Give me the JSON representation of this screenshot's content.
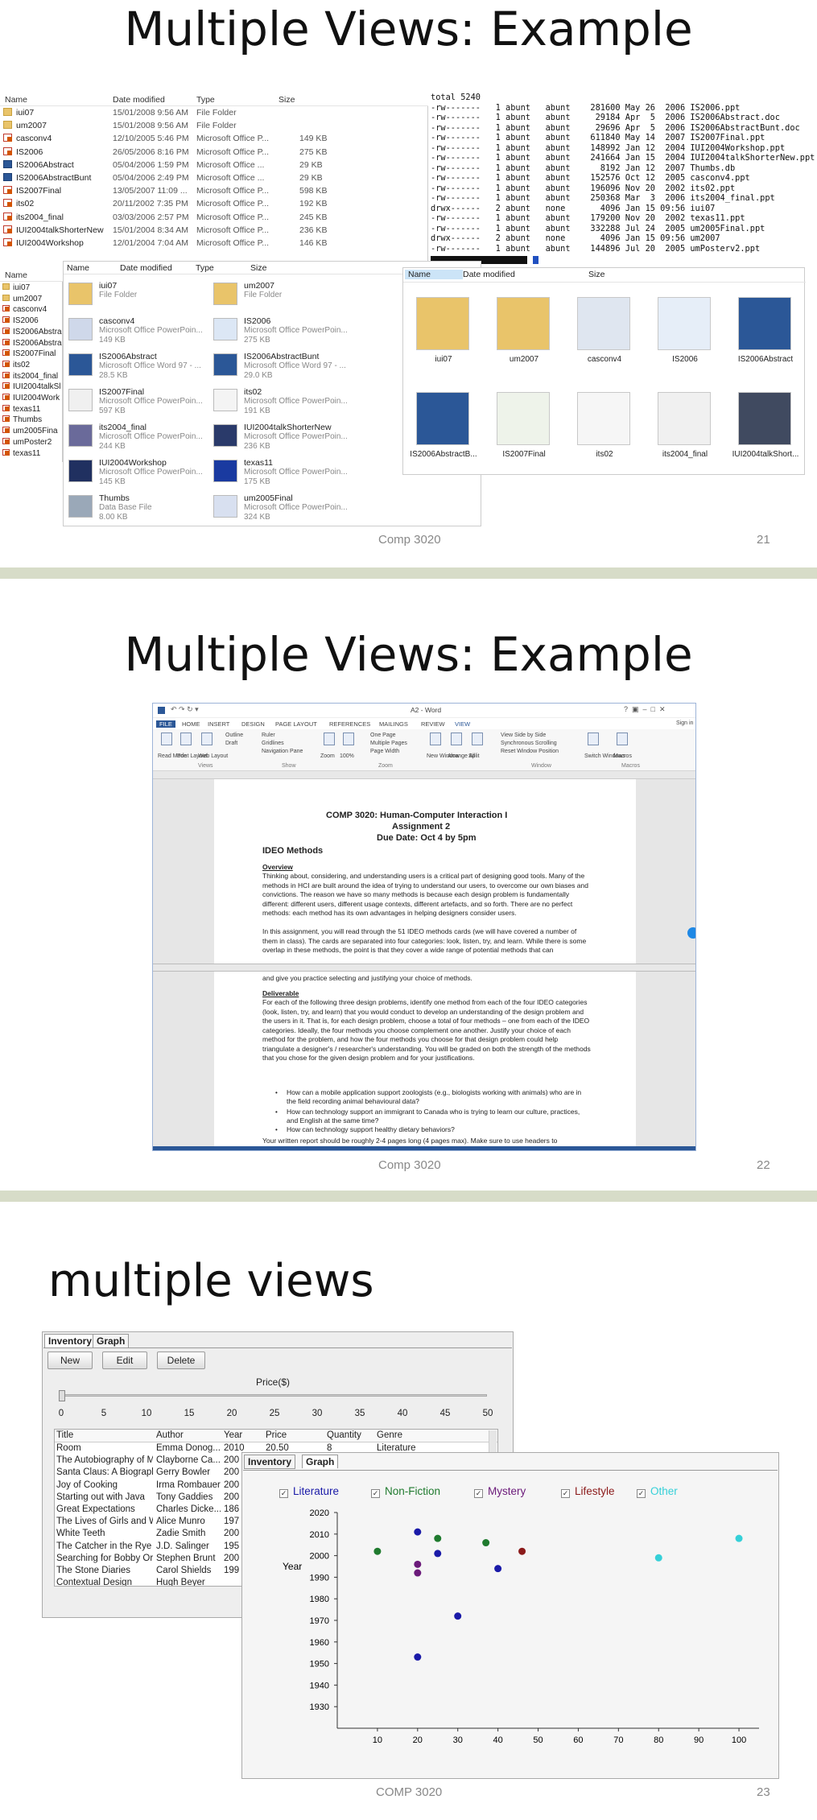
{
  "slide1": {
    "title": "Multiple Views: Example",
    "footer": "Comp 3020",
    "page": "21"
  },
  "slide2": {
    "title": "Multiple Views: Example",
    "footer": "Comp 3020",
    "page": "22"
  },
  "slide3": {
    "title": "multiple views",
    "footer": "COMP 3020",
    "page": "23"
  },
  "explorer_headers": {
    "name": "Name",
    "date": "Date modified",
    "type": "Type",
    "size": "Size"
  },
  "explorer_rows": [
    {
      "name": "iui07",
      "date": "15/01/2008 9:56 AM",
      "type": "File Folder",
      "size": "",
      "icon": "folder"
    },
    {
      "name": "um2007",
      "date": "15/01/2008 9:56 AM",
      "type": "File Folder",
      "size": "",
      "icon": "folder"
    },
    {
      "name": "casconv4",
      "date": "12/10/2005 5:46 PM",
      "type": "Microsoft Office P...",
      "size": "149 KB",
      "icon": "ppt"
    },
    {
      "name": "IS2006",
      "date": "26/05/2006 8:16 PM",
      "type": "Microsoft Office P...",
      "size": "275 KB",
      "icon": "ppt"
    },
    {
      "name": "IS2006Abstract",
      "date": "05/04/2006 1:59 PM",
      "type": "Microsoft Office ...",
      "size": "29 KB",
      "icon": "doc"
    },
    {
      "name": "IS2006AbstractBunt",
      "date": "05/04/2006 2:49 PM",
      "type": "Microsoft Office ...",
      "size": "29 KB",
      "icon": "doc"
    },
    {
      "name": "IS2007Final",
      "date": "13/05/2007 11:09 ...",
      "type": "Microsoft Office P...",
      "size": "598 KB",
      "icon": "ppt"
    },
    {
      "name": "its02",
      "date": "20/11/2002 7:35 PM",
      "type": "Microsoft Office P...",
      "size": "192 KB",
      "icon": "ppt"
    },
    {
      "name": "its2004_final",
      "date": "03/03/2006 2:57 PM",
      "type": "Microsoft Office P...",
      "size": "245 KB",
      "icon": "ppt"
    },
    {
      "name": "IUI2004talkShorterNew",
      "date": "15/01/2004 8:34 AM",
      "type": "Microsoft Office P...",
      "size": "236 KB",
      "icon": "ppt"
    },
    {
      "name": "IUI2004Workshop",
      "date": "12/01/2004 7:04 AM",
      "type": "Microsoft Office P...",
      "size": "146 KB",
      "icon": "ppt"
    }
  ],
  "names_column": [
    "iui07",
    "um2007",
    "casconv4",
    "IS2006",
    "IS2006Abstra",
    "IS2006Abstra",
    "IS2007Final",
    "its02",
    "its2004_final",
    "IUI2004talkSl",
    "IUI2004Work",
    "texas11",
    "Thumbs",
    "um2005Fina",
    "umPoster2",
    "texas11"
  ],
  "ls_lines": [
    "total 5240",
    "-rw-------   1 abunt   abunt    281600 May 26  2006 IS2006.ppt",
    "-rw-------   1 abunt   abunt     29184 Apr  5  2006 IS2006Abstract.doc",
    "-rw-------   1 abunt   abunt     29696 Apr  5  2006 IS2006AbstractBunt.doc",
    "-rw-------   1 abunt   abunt    611840 May 14  2007 IS2007Final.ppt",
    "-rw-------   1 abunt   abunt    148992 Jan 12  2004 IUI2004Workshop.ppt",
    "-rw-------   1 abunt   abunt    241664 Jan 15  2004 IUI2004talkShorterNew.ppt",
    "-rw-------   1 abunt   abunt      8192 Jan 12  2007 Thumbs.db",
    "-rw-------   1 abunt   abunt    152576 Oct 12  2005 casconv4.ppt",
    "-rw-------   1 abunt   abunt    196096 Nov 20  2002 its02.ppt",
    "-rw-------   1 abunt   abunt    250368 Mar  3  2006 its2004_final.ppt",
    "drwx------   2 abunt   none       4096 Jan 15 09:56 iui07",
    "-rw-------   1 abunt   abunt    179200 Nov 20  2002 texas11.ppt",
    "-rw-------   1 abunt   abunt    332288 Jul 24  2005 um2005Final.ppt",
    "drwx------   2 abunt   none       4096 Jan 15 09:56 um2007",
    "-rw-------   1 abunt   abunt    144896 Jul 20  2005 umPosterv2.ppt"
  ],
  "tiles": [
    {
      "name": "iui07",
      "sub": "File Folder",
      "size": ""
    },
    {
      "name": "um2007",
      "sub": "File Folder",
      "size": ""
    },
    {
      "name": "casconv4",
      "sub": "Microsoft Office PowerPoin...",
      "size": "149 KB"
    },
    {
      "name": "IS2006",
      "sub": "Microsoft Office PowerPoin...",
      "size": "275 KB"
    },
    {
      "name": "IS2006Abstract",
      "sub": "Microsoft Office Word 97 - ...",
      "size": "28.5 KB"
    },
    {
      "name": "IS2006AbstractBunt",
      "sub": "Microsoft Office Word 97 - ...",
      "size": "29.0 KB"
    },
    {
      "name": "IS2007Final",
      "sub": "Microsoft Office PowerPoin...",
      "size": "597 KB"
    },
    {
      "name": "its02",
      "sub": "Microsoft Office PowerPoin...",
      "size": "191 KB"
    },
    {
      "name": "its2004_final",
      "sub": "Microsoft Office PowerPoin...",
      "size": "244 KB"
    },
    {
      "name": "IUI2004talkShorterNew",
      "sub": "Microsoft Office PowerPoin...",
      "size": "236 KB"
    },
    {
      "name": "IUI2004Workshop",
      "sub": "Microsoft Office PowerPoin...",
      "size": "145 KB"
    },
    {
      "name": "texas11",
      "sub": "Microsoft Office PowerPoin...",
      "size": "175 KB"
    },
    {
      "name": "Thumbs",
      "sub": "Data Base File",
      "size": "8.00 KB"
    },
    {
      "name": "um2005Final",
      "sub": "Microsoft Office PowerPoin...",
      "size": "324 KB"
    }
  ],
  "big_icons": [
    "iui07",
    "um2007",
    "casconv4",
    "IS2006",
    "IS2006Abstract",
    "IS2006AbstractB...",
    "IS2007Final",
    "its02",
    "its2004_final",
    "IUI2004talkShort..."
  ],
  "word": {
    "title": "A2 - Word",
    "signin": "Sign in",
    "tabs": [
      "FILE",
      "HOME",
      "INSERT",
      "DESIGN",
      "PAGE LAYOUT",
      "REFERENCES",
      "MAILINGS",
      "REVIEW",
      "VIEW"
    ],
    "views": [
      "Read Mode",
      "Print Layout",
      "Web Layout"
    ],
    "view_checks": [
      "Outline",
      "Draft"
    ],
    "show": [
      "Ruler",
      "Gridlines",
      "Navigation Pane"
    ],
    "zoom": [
      "Zoom",
      "100%",
      "One Page",
      "Multiple Pages",
      "Page Width"
    ],
    "window": [
      "New Window",
      "Arrange All",
      "Split",
      "View Side by Side",
      "Synchronous Scrolling",
      "Reset Window Position",
      "Switch Windows",
      "Macros"
    ],
    "groups": [
      "Views",
      "Show",
      "Zoom",
      "Window",
      "Macros"
    ],
    "h1": "COMP 3020: Human-Computer Interaction I",
    "h2": "Assignment 2",
    "h3": "Due Date: Oct 4 by 5pm",
    "section": "IDEO Methods",
    "overview": "Overview",
    "p1": "Thinking about, considering, and understanding users is a critical part of designing good tools. Many of the methods in HCI are built around the idea of trying to understand our users, to overcome our own biases and convictions. The reason we have so many methods is because each design problem is fundamentally different: different users, different usage contexts, different artefacts, and so forth. There are no perfect methods: each method has its own advantages in helping designers consider users.",
    "p2": "In this assignment, you will read through the 51 IDEO methods cards (we will have covered a number of them in class). The cards are separated into four categories: look, listen, try, and learn. While there is some overlap in these methods, the point is that they cover a wide range of potential methods that can",
    "p2b": "and give you practice selecting and justifying your choice of methods.",
    "deliverable": "Deliverable",
    "p3": "For each of the following three design problems, identify one method from each of the four IDEO categories (look, listen, try, and learn) that you would conduct to develop an understanding of the design problem and the users in it. That is, for each design problem, choose a total of four methods – one from each of the IDEO categories. Ideally, the four methods you choose complement one another. Justify your choice of each method for the problem, and how the four methods you choose for that design problem could help triangulate a designer's / researcher's understanding.  You will be graded on both the strength of the methods that you chose for the given design problem and for your justifications.",
    "bullets": [
      "How can a mobile application support zoologists (e.g., biologists working with animals) who are in the field recording animal behavioural data?",
      "How can technology support an immigrant to Canada who is trying to learn our culture, practices, and English at the same time?",
      "How can technology support healthy dietary behaviors?"
    ],
    "p4": "Your written report should be roughly 2-4 pages long (4 pages max). Make sure to use headers to"
  },
  "inventory": {
    "tabs": [
      "Inventory",
      "Graph"
    ],
    "buttons": [
      "New",
      "Edit",
      "Delete"
    ],
    "slider_label": "Price($)",
    "slider_ticks": [
      "0",
      "5",
      "10",
      "15",
      "20",
      "25",
      "30",
      "35",
      "40",
      "45",
      "50"
    ],
    "slider_value": 0,
    "columns": [
      "Title",
      "Author",
      "Year",
      "Price",
      "Quantity",
      "Genre"
    ],
    "rows": [
      [
        "Room",
        "Emma Donog...",
        "2010",
        "20.50",
        "8",
        "Literature"
      ],
      [
        "The Autobiography of M...",
        "Clayborne Ca...",
        "200",
        "",
        "",
        ""
      ],
      [
        "Santa Claus: A Biography",
        "Gerry Bowler",
        "200",
        "",
        "",
        ""
      ],
      [
        "Joy of Cooking",
        "Irma Rombauer",
        "200",
        "",
        "",
        ""
      ],
      [
        "Starting out with Java",
        "Tony Gaddies",
        "200",
        "",
        "",
        ""
      ],
      [
        "Great Expectations",
        "Charles Dicke...",
        "186",
        "",
        "",
        ""
      ],
      [
        "The Lives of Girls and W...",
        "Alice Munro",
        "197",
        "",
        "",
        ""
      ],
      [
        "White Teeth",
        "Zadie Smith",
        "200",
        "",
        "",
        ""
      ],
      [
        "The Catcher in the Rye",
        "J.D. Salinger",
        "195",
        "",
        "",
        ""
      ],
      [
        "Searching for Bobby Orr",
        "Stephen Brunt",
        "200",
        "",
        "",
        ""
      ],
      [
        "The Stone Diaries",
        "Carol Shields",
        "199",
        "",
        "",
        ""
      ],
      [
        "Contextual Design",
        "Hugh Beyer",
        "",
        "",
        "",
        ""
      ]
    ]
  },
  "graph_window": {
    "tabs": [
      "Inventory",
      "Graph"
    ],
    "filters": [
      {
        "label": "Literature",
        "color": "#1a1aa8"
      },
      {
        "label": "Non-Fiction",
        "color": "#1f7a2e"
      },
      {
        "label": "Mystery",
        "color": "#6b1a7a"
      },
      {
        "label": "Lifestyle",
        "color": "#8b1a1a"
      },
      {
        "label": "Other",
        "color": "#35d0d8"
      }
    ]
  },
  "chart_data": {
    "type": "scatter",
    "title": "",
    "xlabel": "",
    "ylabel": "Year",
    "xlim": [
      0,
      105
    ],
    "ylim": [
      1920,
      2020
    ],
    "x_ticks": [
      "10",
      "20",
      "30",
      "40",
      "50",
      "60",
      "70",
      "80",
      "90",
      "100"
    ],
    "y_ticks": [
      "1930",
      "1940",
      "1950",
      "1960",
      "1970",
      "1980",
      "1990",
      "2000",
      "2010",
      "2020"
    ],
    "series": [
      {
        "name": "Literature",
        "color": "#1a1aa8",
        "points": [
          [
            20,
            2011
          ],
          [
            25,
            2001
          ],
          [
            40,
            1994
          ],
          [
            30,
            1972
          ],
          [
            20,
            1953
          ]
        ]
      },
      {
        "name": "Non-Fiction",
        "color": "#1f7a2e",
        "points": [
          [
            10,
            2002
          ],
          [
            25,
            2008
          ],
          [
            37,
            2006
          ]
        ]
      },
      {
        "name": "Mystery",
        "color": "#6b1a7a",
        "points": [
          [
            20,
            1996
          ],
          [
            20,
            1992
          ]
        ]
      },
      {
        "name": "Lifestyle",
        "color": "#8b1a1a",
        "points": [
          [
            46,
            2002
          ]
        ]
      },
      {
        "name": "Other",
        "color": "#35d0d8",
        "points": [
          [
            80,
            1999
          ],
          [
            100,
            2008
          ]
        ]
      }
    ]
  }
}
